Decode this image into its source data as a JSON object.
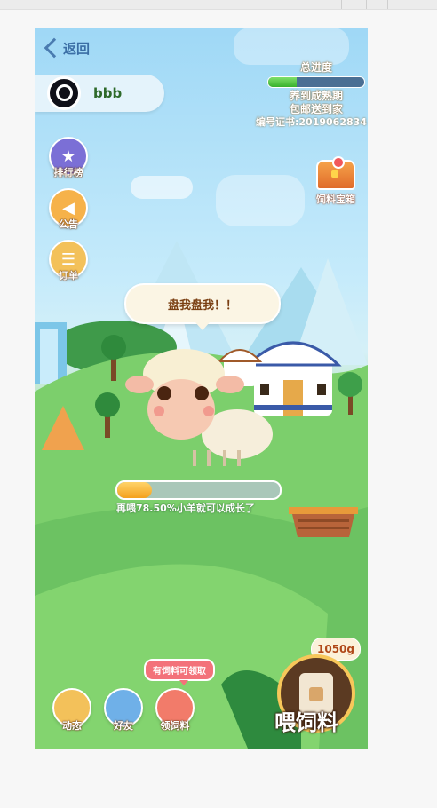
{
  "nav": {
    "back_label": "返回"
  },
  "user": {
    "name": "bbb"
  },
  "progress": {
    "title": "总进度",
    "value": 0.3,
    "line1": "养到成熟期",
    "line2": "包邮送到家",
    "certificate": "编号证书:2019062834"
  },
  "side_menu": [
    {
      "label": "排行榜",
      "icon": "trophy-icon",
      "color": "#7b6fd6"
    },
    {
      "label": "公告",
      "icon": "megaphone-icon",
      "color": "#f6b24a"
    },
    {
      "label": "订单",
      "icon": "order-icon",
      "color": "#f3c15a"
    }
  ],
  "chest": {
    "label": "饲料宝箱",
    "has_notification": true
  },
  "speech": {
    "text": "盘我盘我！！"
  },
  "growth": {
    "percent": 0.215,
    "text": "再喂78.50%小羊就可以成长了"
  },
  "bottom_menu": [
    {
      "label": "动态",
      "icon": "news-icon",
      "color": "#f3c15a"
    },
    {
      "label": "好友",
      "icon": "friends-icon",
      "color": "#6fb0e8"
    },
    {
      "label": "领饲料",
      "icon": "feed-bag-icon",
      "color": "#f27b6a"
    }
  ],
  "claim_tip": "有饲料可领取",
  "feed": {
    "amount": "1050g",
    "label": "喂饲料"
  },
  "colors": {
    "accent": "#f4a11e",
    "sky": "#9fd8f6",
    "grass": "#7fcf72",
    "title_shadow": "#8a6a3a"
  }
}
